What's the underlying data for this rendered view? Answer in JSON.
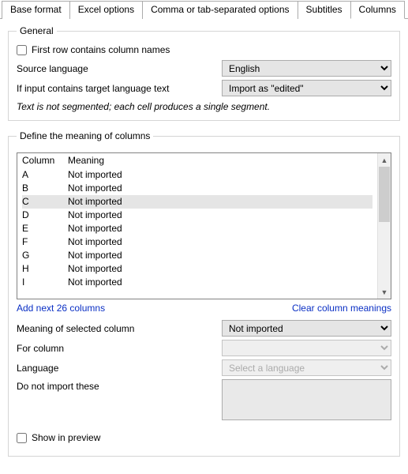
{
  "tabs": {
    "base": "Base format",
    "excel": "Excel options",
    "csv": "Comma or tab-separated options",
    "subtitles": "Subtitles",
    "columns": "Columns"
  },
  "general": {
    "legend": "General",
    "first_row_label": "First row contains column names",
    "source_lang_label": "Source language",
    "source_lang_value": "English",
    "target_lang_label": "If input contains target language text",
    "target_lang_value": "Import as \"edited\"",
    "note": "Text is not segmented; each cell produces a single segment."
  },
  "columns_section": {
    "legend": "Define the meaning of columns",
    "header_col": "Column",
    "header_meaning": "Meaning",
    "rows": [
      {
        "col": "A",
        "meaning": "Not imported"
      },
      {
        "col": "B",
        "meaning": "Not imported"
      },
      {
        "col": "C",
        "meaning": "Not imported"
      },
      {
        "col": "D",
        "meaning": "Not imported"
      },
      {
        "col": "E",
        "meaning": "Not imported"
      },
      {
        "col": "F",
        "meaning": "Not imported"
      },
      {
        "col": "G",
        "meaning": "Not imported"
      },
      {
        "col": "H",
        "meaning": "Not imported"
      },
      {
        "col": "I",
        "meaning": "Not imported"
      }
    ],
    "selected_index": 2,
    "add_link": "Add next 26 columns",
    "clear_link": "Clear column meanings",
    "meaning_label": "Meaning of selected column",
    "meaning_value": "Not imported",
    "for_column_label": "For column",
    "for_column_value": "",
    "language_label": "Language",
    "language_placeholder": "Select a language",
    "do_not_label": "Do not import these",
    "show_preview_label": "Show in preview"
  }
}
